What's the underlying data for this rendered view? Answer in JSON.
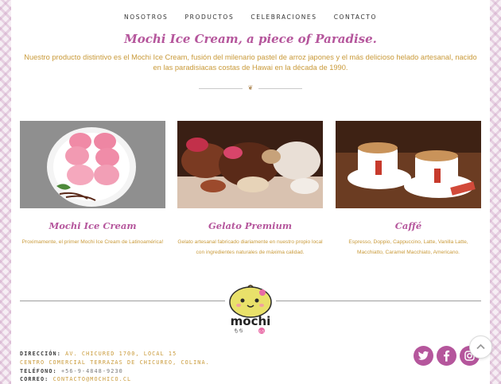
{
  "nav": {
    "items": [
      "NOSOTROS",
      "PRODUCTOS",
      "CELEBRACIONES",
      "CONTACTO"
    ]
  },
  "hero": {
    "title": "Mochi Ice Cream, a piece of Paradise.",
    "text": "Nuestro producto distintivo es el Mochi Ice Cream, fusión del milenario pastel de arroz japones y el más delicioso helado artesanal, nacido en las paradisiacas costas de Hawai en la década de 1990."
  },
  "cards": [
    {
      "title": "Mochi Ice Cream",
      "description": "Proximamente, el primer Mochi Ice Cream de Latinoamérica!",
      "image_icon": "mochi-plate-photo"
    },
    {
      "title": "Gelato Premium",
      "description": "Gelato artesanal fabricado diariamente en nuestro propio local con ingredientes naturales de máxima calidad.",
      "image_icon": "gelato-photo"
    },
    {
      "title": "Caffé",
      "description": "Espresso, Doppio, Cappuccino,  Latte, Vanilla Latte, Macchiatto, Caramel Macchiato, Americano.",
      "image_icon": "coffee-cups-photo"
    }
  ],
  "logo": {
    "text": "mochi",
    "subtext": "もち",
    "badge": "もち"
  },
  "footer": {
    "address_label": "DIRECCIÓN:",
    "address_value": "AV. CHICURED 1700, LOCAL 15",
    "address_line2": "CENTRO COMERCIAL TERRAZAS DE CHICUREO, COLINA.",
    "phone_label": "TELÉFONO:",
    "phone_value": "+56-9-4848-9230",
    "email_label": "CORREO:",
    "email_value": "CONTACTO@MOCHICO.CL"
  },
  "social": [
    "twitter-icon",
    "facebook-icon",
    "instagram-icon"
  ],
  "colors": {
    "accent": "#b5569c",
    "gold": "#c99a3a",
    "text": "#333333"
  }
}
